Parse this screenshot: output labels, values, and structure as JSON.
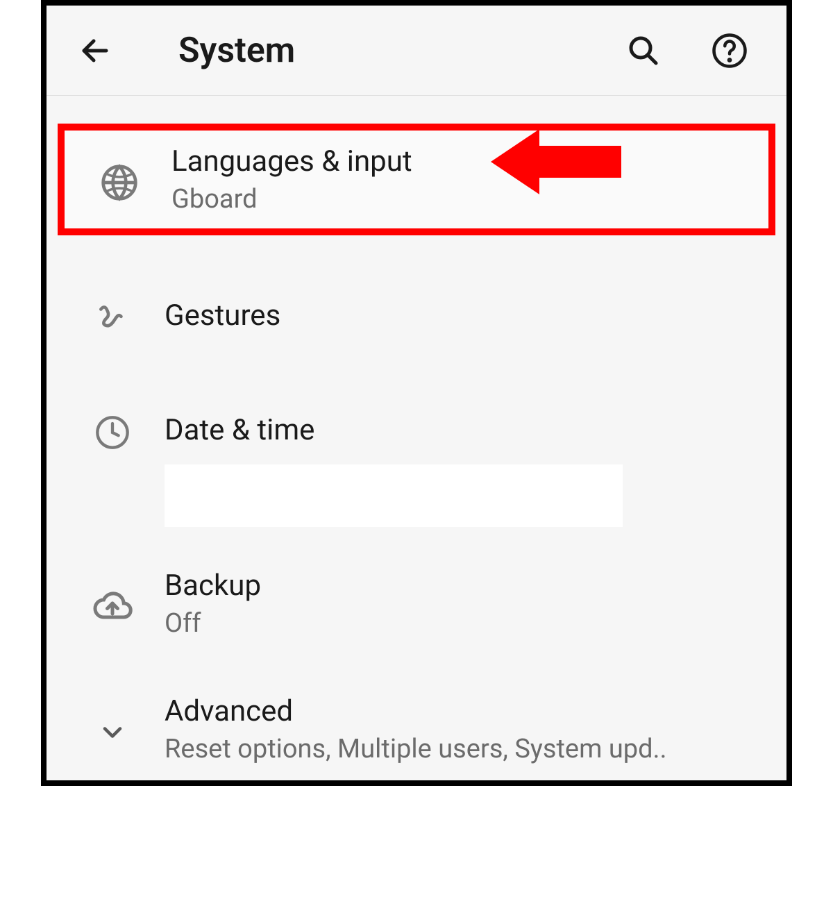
{
  "header": {
    "title": "System"
  },
  "settings": [
    {
      "key": "languages_input",
      "title": "Languages & input",
      "subtitle": "Gboard",
      "icon": "globe-icon",
      "highlighted": true
    },
    {
      "key": "gestures",
      "title": "Gestures",
      "subtitle": "",
      "icon": "gesture-icon"
    },
    {
      "key": "date_time",
      "title": "Date & time",
      "subtitle": "",
      "icon": "clock-icon"
    },
    {
      "key": "backup",
      "title": "Backup",
      "subtitle": "Off",
      "icon": "cloud-upload-icon"
    },
    {
      "key": "advanced",
      "title": "Advanced",
      "subtitle": "Reset options, Multiple users, System upd..",
      "icon": "chevron-down-icon"
    }
  ],
  "annotation": {
    "arrow_color": "#ff0000",
    "highlight_color": "#ff0000"
  }
}
